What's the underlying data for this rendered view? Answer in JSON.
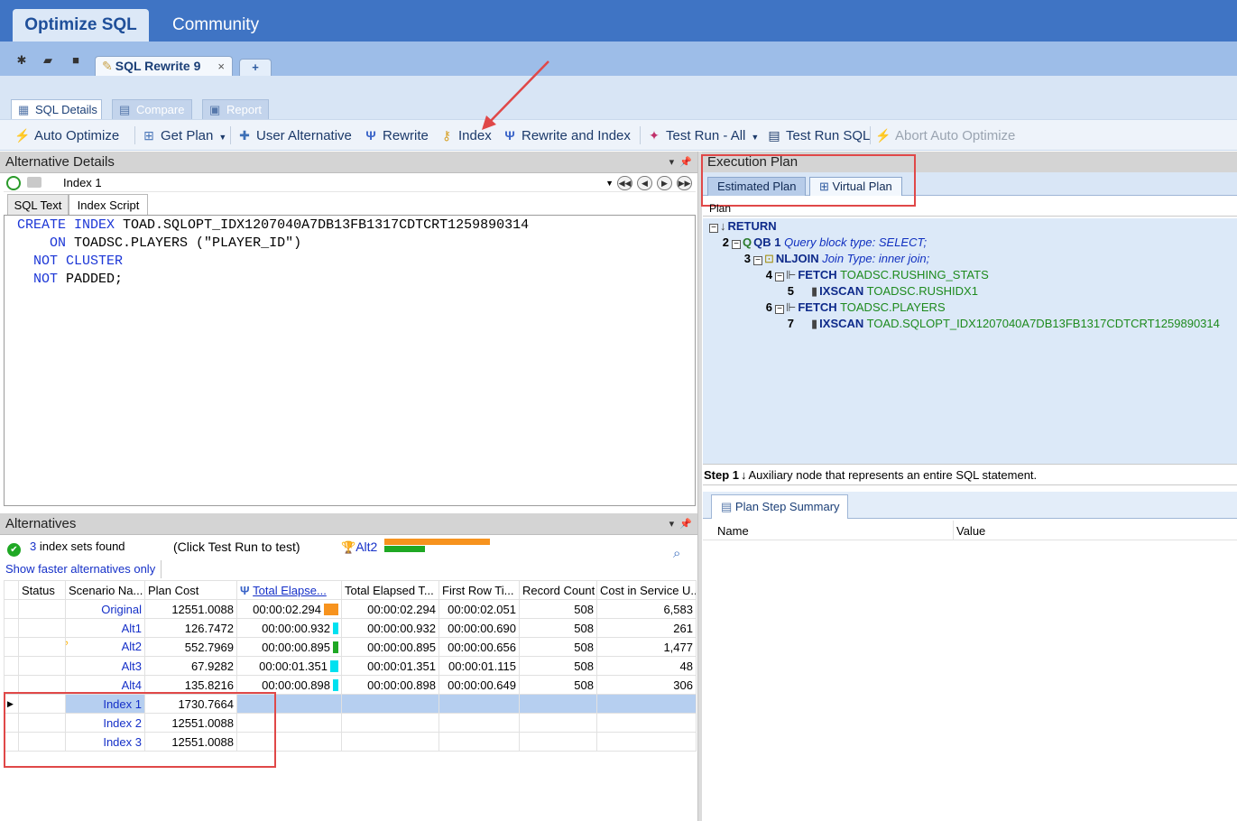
{
  "app_tabs": {
    "active": "Optimize SQL",
    "other": "Community"
  },
  "doc_tab": {
    "label": "SQL Rewrite 9",
    "close": "×",
    "add": "+"
  },
  "sub_tabs": {
    "details": "SQL Details",
    "compare": "Compare",
    "report": "Report"
  },
  "toolbar": {
    "auto_optimize": "Auto Optimize",
    "get_plan": "Get Plan",
    "user_alternative": "User Alternative",
    "rewrite": "Rewrite",
    "index": "Index",
    "rewrite_and_index": "Rewrite and Index",
    "test_run_all": "Test Run - All",
    "test_run_sql": "Test Run SQL",
    "abort_auto_optimize": "Abort Auto Optimize"
  },
  "alt_details": {
    "title": "Alternative Details",
    "selected": "Index 1",
    "tabs": {
      "sql_text": "SQL Text",
      "index_script": "Index Script"
    },
    "code": [
      {
        "k1": "CREATE",
        "k2": "INDEX",
        "rest": " TOAD.SQLOPT_IDX1207040A7DB13FB1317CDTCRT1259890314",
        "indent": ""
      },
      {
        "k1": "ON",
        "k2": "",
        "rest": " TOADSC.PLAYERS (\"PLAYER_ID\")",
        "indent": "    "
      },
      {
        "k1": "NOT",
        "k2": "CLUSTER",
        "rest": "",
        "indent": "  "
      },
      {
        "k1": "NOT",
        "k2": "",
        "rest": " PADDED;",
        "indent": "  "
      }
    ]
  },
  "alternatives": {
    "title": "Alternatives",
    "count": "3",
    "found_text": "index sets found",
    "hint": "(Click Test Run to test)",
    "best": "Alt2",
    "faster_link": "Show faster alternatives only",
    "columns": [
      "Status",
      "Scenario Na...",
      "Plan Cost",
      "Total Elapse...",
      "Total Elapsed T...",
      "First Row Ti...",
      "Record Count",
      "Cost in Service U..."
    ],
    "rows": [
      {
        "name": "Original",
        "cost": "12551.0088",
        "elapsed": "00:00:02.294",
        "bar": "orange",
        "bar_frac": 1.0,
        "total": "00:00:02.294",
        "first": "00:00:02.051",
        "records": "508",
        "service": "6,583"
      },
      {
        "name": "Alt1",
        "cost": "126.7472",
        "elapsed": "00:00:00.932",
        "bar": "cyan",
        "bar_frac": 0.4,
        "total": "00:00:00.932",
        "first": "00:00:00.690",
        "records": "508",
        "service": "261"
      },
      {
        "name": "Alt2",
        "cost": "552.7969",
        "elapsed": "00:00:00.895",
        "bar": "green",
        "bar_frac": 0.39,
        "total": "00:00:00.895",
        "first": "00:00:00.656",
        "records": "508",
        "service": "1,477"
      },
      {
        "name": "Alt3",
        "cost": "67.9282",
        "elapsed": "00:00:01.351",
        "bar": "cyan",
        "bar_frac": 0.59,
        "total": "00:00:01.351",
        "first": "00:00:01.115",
        "records": "508",
        "service": "48"
      },
      {
        "name": "Alt4",
        "cost": "135.8216",
        "elapsed": "00:00:00.898",
        "bar": "cyan",
        "bar_frac": 0.39,
        "total": "00:00:00.898",
        "first": "00:00:00.649",
        "records": "508",
        "service": "306"
      },
      {
        "name": "Index 1",
        "cost": "1730.7664",
        "elapsed": "",
        "bar": "",
        "total": "",
        "first": "",
        "records": "",
        "service": ""
      },
      {
        "name": "Index 2",
        "cost": "12551.0088",
        "elapsed": "",
        "bar": "",
        "total": "",
        "first": "",
        "records": "",
        "service": ""
      },
      {
        "name": "Index 3",
        "cost": "12551.0088",
        "elapsed": "",
        "bar": "",
        "total": "",
        "first": "",
        "records": "",
        "service": ""
      }
    ]
  },
  "execution_plan": {
    "title": "Execution Plan",
    "tabs": {
      "estimated": "Estimated Plan",
      "virtual": "Virtual Plan"
    },
    "column": "Plan",
    "nodes": [
      {
        "num": "",
        "op": "RETURN",
        "obj": "",
        "desc": ""
      },
      {
        "num": "2",
        "op": "QB 1",
        "obj": "",
        "desc": "Query block type: SELECT;"
      },
      {
        "num": "3",
        "op": "NLJOIN",
        "obj": "",
        "desc": "Join Type: inner join;"
      },
      {
        "num": "4",
        "op": "FETCH",
        "obj": "TOADSC.RUSHING_STATS",
        "desc": ""
      },
      {
        "num": "5",
        "op": "IXSCAN",
        "obj": "TOADSC.RUSHIDX1",
        "desc": ""
      },
      {
        "num": "6",
        "op": "FETCH",
        "obj": "TOADSC.PLAYERS",
        "desc": ""
      },
      {
        "num": "7",
        "op": "IXSCAN",
        "obj": "TOAD.SQLOPT_IDX1207040A7DB13FB1317CDTCRT1259890314",
        "desc": ""
      }
    ],
    "step_label": "Step 1",
    "step_desc": "Auxiliary node that represents an entire SQL statement.",
    "summary_tab": "Plan Step Summary",
    "summary_cols": {
      "name": "Name",
      "value": "Value"
    }
  },
  "colors": {
    "orange": "#f7931e",
    "cyan": "#00e1f0",
    "green": "#1fa824",
    "accent": "#3f74c4"
  }
}
